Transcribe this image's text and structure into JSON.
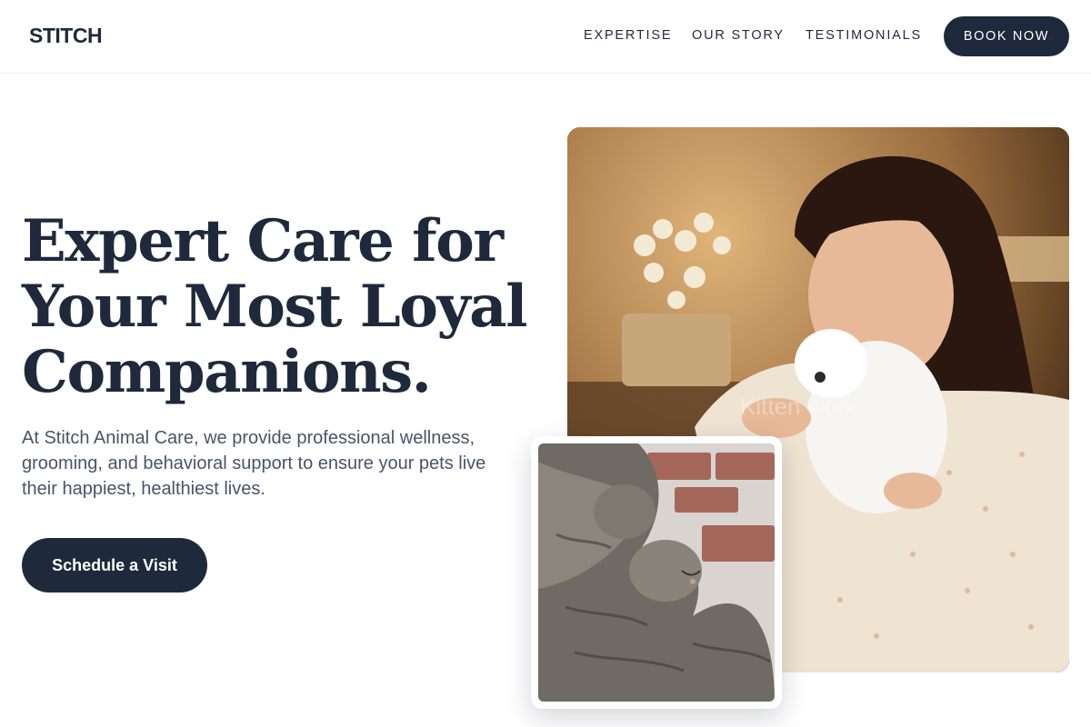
{
  "header": {
    "logo": "STITCH",
    "nav": {
      "expertise": "EXPERTISE",
      "story": "OUR STORY",
      "testimonials": "TESTIMONIALS"
    },
    "book_label": "BOOK NOW"
  },
  "hero": {
    "title_lines": [
      "Expert Care for",
      "Your Most Loyal",
      "Companions."
    ],
    "description": "At Stitch Animal Care, we provide professional wellness, grooming, and behavioral support to ensure your pets live their happiest, healthiest lives.",
    "cta_label": "Schedule a Visit"
  },
  "images": {
    "main_watermark": "Kitten work"
  },
  "colors": {
    "primary": "#1e293b",
    "text_muted": "#475569",
    "background": "#ffffff"
  }
}
